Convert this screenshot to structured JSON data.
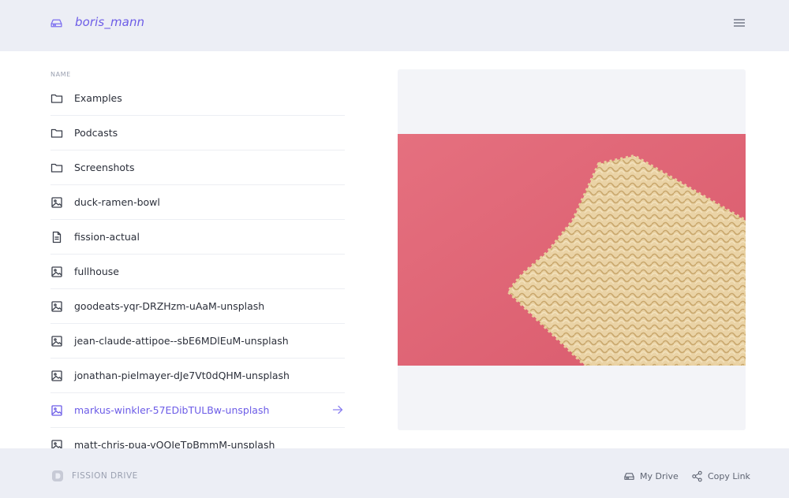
{
  "header": {
    "username": "boris_mann",
    "drive_icon": "drive-icon",
    "menu_icon": "hamburger-menu-icon"
  },
  "file_list": {
    "column_header": "NAME",
    "items": [
      {
        "name": "Examples",
        "type": "folder"
      },
      {
        "name": "Podcasts",
        "type": "folder"
      },
      {
        "name": "Screenshots",
        "type": "folder"
      },
      {
        "name": "duck-ramen-bowl",
        "type": "image"
      },
      {
        "name": "fission-actual",
        "type": "document"
      },
      {
        "name": "fullhouse",
        "type": "image"
      },
      {
        "name": "goodeats-yqr-DRZHzm-uAaM-unsplash",
        "type": "image"
      },
      {
        "name": "jean-claude-attipoe--sbE6MDlEuM-unsplash",
        "type": "image"
      },
      {
        "name": "jonathan-pielmayer-dJe7Vt0dQHM-unsplash",
        "type": "image"
      },
      {
        "name": "markus-winkler-57EDibTULBw-unsplash",
        "type": "image",
        "selected": true
      },
      {
        "name": "matt-chris-pua-vQQJeTpBmmM-unsplash",
        "type": "image"
      }
    ]
  },
  "preview": {
    "image_subject": "dried ramen noodle block on pink background"
  },
  "footer": {
    "brand": "FISSION DRIVE",
    "my_drive": "My Drive",
    "copy_link": "Copy Link"
  },
  "colors": {
    "accent": "#6c5ce7",
    "header_bg": "#eceef5",
    "text": "#2b2f3a",
    "muted": "#9aa0b0"
  }
}
